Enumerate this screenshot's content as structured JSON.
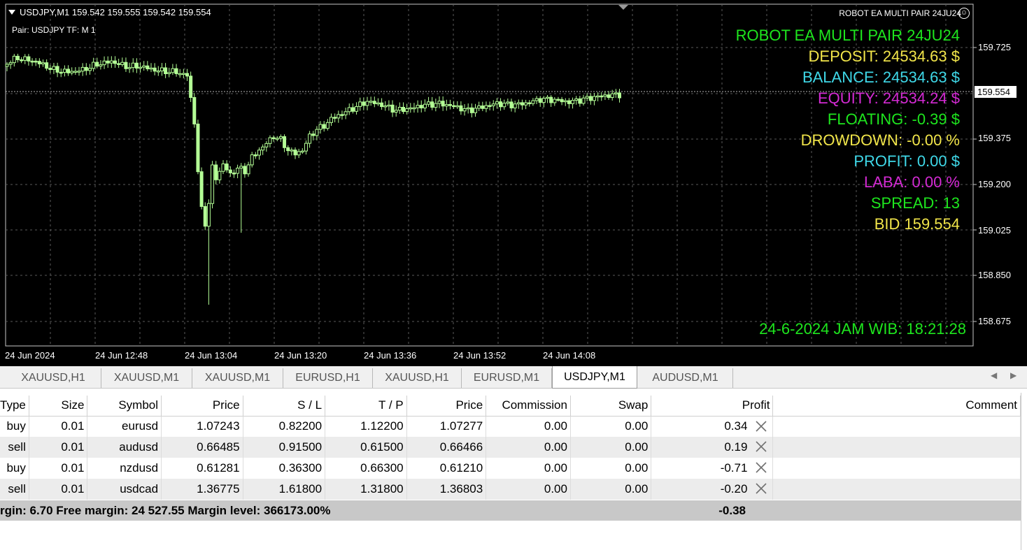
{
  "chart": {
    "header": "USDJPY,M1  159.542 159.555 159.542 159.554",
    "pair_tf": "Pair: USDJPY TF: M 1",
    "ea_name": "ROBOT EA MULTI PAIR 24JU24",
    "current_price": "159.554",
    "price_axis": [
      "159.725",
      "159.375",
      "159.200",
      "159.025",
      "158.850",
      "158.675"
    ],
    "time_axis": [
      "24 Jun 2024",
      "24 Jun 12:48",
      "24 Jun 13:04",
      "24 Jun 13:20",
      "24 Jun 13:36",
      "24 Jun 13:52",
      "24 Jun 14:08"
    ],
    "colors": {
      "background": "#000000",
      "candle": "#b4ff96",
      "grid": "#5a5a5a"
    }
  },
  "info_panel": [
    {
      "text": "ROBOT EA MULTI PAIR 24JU24",
      "color": "#1ee61e"
    },
    {
      "text": "DEPOSIT: 24534.63 $",
      "color": "#f2e64a"
    },
    {
      "text": "BALANCE: 24534.63 $",
      "color": "#3fd8e8"
    },
    {
      "text": "EQUITY: 24534.24 $",
      "color": "#d42ad4"
    },
    {
      "text": "FLOATING: -0.39 $",
      "color": "#1ee61e"
    },
    {
      "text": "DROWDOWN: -0.00 %",
      "color": "#f2e64a"
    },
    {
      "text": "PROFIT: 0.00 $",
      "color": "#3fd8e8"
    },
    {
      "text": "LABA: 0.00 %",
      "color": "#d42ad4"
    },
    {
      "text": "SPREAD: 13",
      "color": "#1ee61e"
    },
    {
      "text": "BID 159.554",
      "color": "#f2e64a"
    }
  ],
  "clock": "24-6-2024 JAM WIB: 18:21:28",
  "tabs": [
    {
      "label": "XAUUSD,H1",
      "active": false
    },
    {
      "label": "XAUUSD,M1",
      "active": false
    },
    {
      "label": "XAUUSD,M1",
      "active": false
    },
    {
      "label": "EURUSD,H1",
      "active": false
    },
    {
      "label": "XAUUSD,H1",
      "active": false
    },
    {
      "label": "EURUSD,M1",
      "active": false
    },
    {
      "label": "USDJPY,M1",
      "active": true
    },
    {
      "label": "AUDUSD,M1",
      "active": false
    }
  ],
  "table": {
    "headers": [
      "Type",
      "Size",
      "Symbol",
      "Price",
      "S / L",
      "T / P",
      "Price",
      "Commission",
      "Swap",
      "Profit",
      "Comment"
    ],
    "rows": [
      [
        "buy",
        "0.01",
        "eurusd",
        "1.07243",
        "0.82200",
        "1.12200",
        "1.07277",
        "0.00",
        "0.00",
        "0.34",
        ""
      ],
      [
        "sell",
        "0.01",
        "audusd",
        "0.66485",
        "0.91500",
        "0.61500",
        "0.66466",
        "0.00",
        "0.00",
        "0.19",
        ""
      ],
      [
        "buy",
        "0.01",
        "nzdusd",
        "0.61281",
        "0.36300",
        "0.66300",
        "0.61210",
        "0.00",
        "0.00",
        "-0.71",
        ""
      ],
      [
        "sell",
        "0.01",
        "usdcad",
        "1.36775",
        "1.61800",
        "1.31800",
        "1.36803",
        "0.00",
        "0.00",
        "-0.20",
        ""
      ]
    ],
    "summary": "rgin: 6.70  Free margin: 24 527.55  Margin level: 366173.00%",
    "total": "-0.38"
  }
}
